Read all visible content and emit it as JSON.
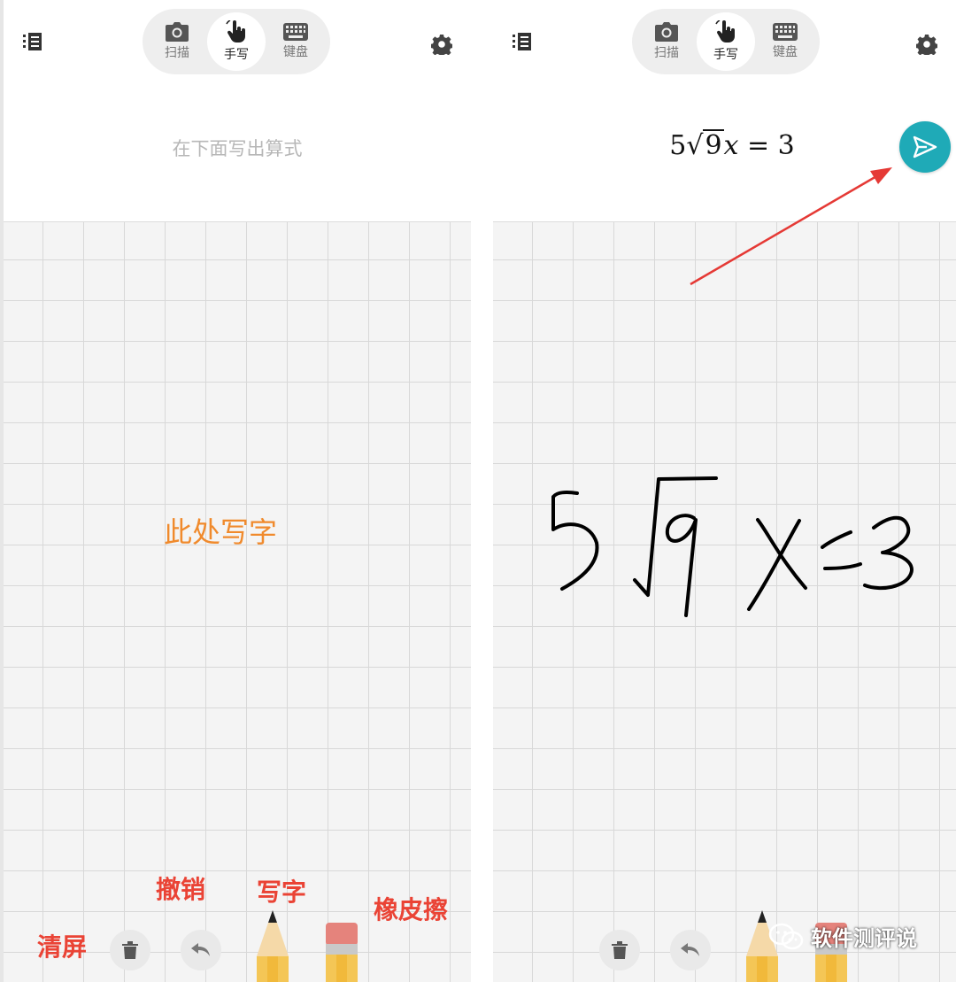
{
  "left_panel": {
    "modes": [
      {
        "label": "扫描",
        "icon": "camera-icon",
        "active": false
      },
      {
        "label": "手写",
        "icon": "hand-pointer-icon",
        "active": true
      },
      {
        "label": "键盘",
        "icon": "keyboard-icon",
        "active": false
      }
    ],
    "hint": "在下面写出算式",
    "canvas_hint": "此处写字",
    "annotations": {
      "clear": "清屏",
      "undo": "撤销",
      "write": "写字",
      "eraser": "橡皮擦"
    }
  },
  "right_panel": {
    "modes": [
      {
        "label": "扫描",
        "icon": "camera-icon",
        "active": false
      },
      {
        "label": "手写",
        "icon": "hand-pointer-icon",
        "active": true
      },
      {
        "label": "键盘",
        "icon": "keyboard-icon",
        "active": false
      }
    ],
    "formula": {
      "coef": "5",
      "radicand": "9",
      "var": "x",
      "rhs": "= 3"
    }
  },
  "watermark": "软件测评说",
  "colors": {
    "accent": "#1faab7",
    "annotation": "#ea4335",
    "canvas_hint": "#f08a2c",
    "arrow": "#e53935"
  }
}
